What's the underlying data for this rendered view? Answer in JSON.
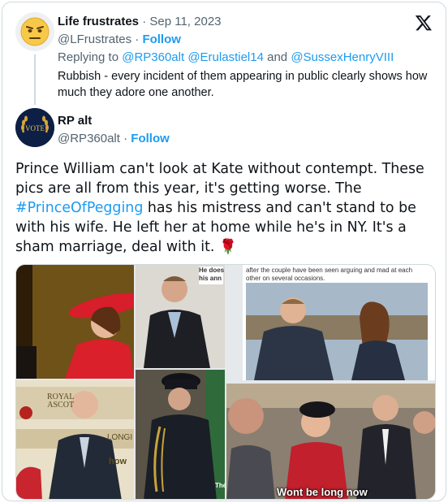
{
  "reply_post": {
    "display_name": "Life frustrates",
    "date": "Sep 11, 2023",
    "handle": "@LFrustrates",
    "follow_label": "Follow",
    "replying_to_label": "Replying to",
    "replying_to": [
      "@RP360alt",
      "@Erulastiel14",
      "@SussexHenryVIII"
    ],
    "and_label": "and",
    "text": "Rubbish - every incident of them appearing in public clearly shows how much they adore one another."
  },
  "main_post": {
    "display_name": "RP alt",
    "handle": "@RP360alt",
    "follow_label": "Follow",
    "avatar_text": "VOTE",
    "text_before_link": "Prince William can't look at Kate without contempt. These pics are all from this year, it's getting worse. The ",
    "hashtag": "#PrinceOfPegging",
    "text_after_link": " has his mistress and can't stand to be with his wife. He left her at home while he's in NY. It's a sham marriage, deal with it. ",
    "rose_emoji": "🌹"
  },
  "media": {
    "caption_tile2": "He does\nhis ann",
    "caption_tile3": "after the couple have been seen arguing and mad at each other on several occasions.",
    "sign_tile4": "ROYAL\nASCOT",
    "sign_tile4_right": "LONGI",
    "sign_tile4_how": "how",
    "label_tile5": "Thé",
    "overlay_caption": "Wont be long now"
  },
  "colors": {
    "accent": "#1d9bf0",
    "muted": "#536471",
    "text": "#0f1419"
  }
}
